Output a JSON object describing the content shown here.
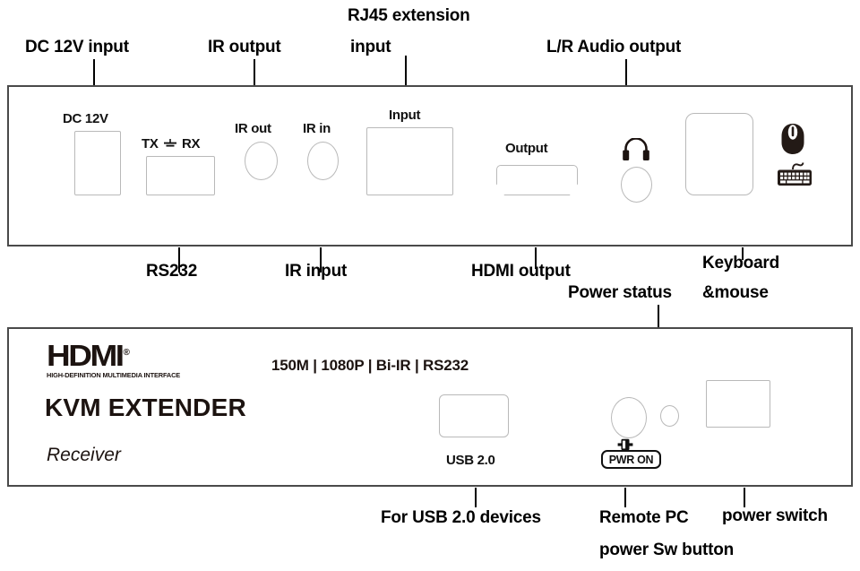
{
  "diagram": {
    "title": "HDMI KVM Extender Receiver port diagram",
    "line_color": "#000000",
    "panel_border_color": "#4a4a4a",
    "port_outline_color": "#b9b9b9",
    "brand_color": "#1c1310"
  },
  "top_panel": {
    "name": "receiver-rear-panel",
    "callouts_above": [
      {
        "id": "dc-12v-input",
        "label": "DC 12V input"
      },
      {
        "id": "ir-output",
        "label": "IR output"
      },
      {
        "id": "rj45-extension-input",
        "label_line1": "RJ45 extension",
        "label_line2": "input"
      },
      {
        "id": "lr-audio-output",
        "label": "L/R Audio output"
      }
    ],
    "callouts_below": [
      {
        "id": "rs232",
        "label": "RS232"
      },
      {
        "id": "ir-input",
        "label": "IR input"
      },
      {
        "id": "hdmi-output",
        "label": "HDMI output"
      },
      {
        "id": "power-status",
        "label": "Power status"
      },
      {
        "id": "keyboard-mouse",
        "label_line1": "Keyboard",
        "label_line2": "&mouse"
      }
    ],
    "port_labels": {
      "dc_jack": "DC 12V",
      "serial_tx": "TX",
      "serial_rx": "RX",
      "ir_out": "IR out",
      "ir_in": "IR in",
      "rj45_input": "Input",
      "hdmi_output": "Output"
    },
    "icons": {
      "ground": "ground-symbol",
      "audio": "headphone-icon",
      "mouse": "mouse-icon",
      "keyboard": "keyboard-icon"
    }
  },
  "bottom_panel": {
    "name": "receiver-front-panel",
    "brand": {
      "wordmark": "HDMI",
      "registered": "®",
      "subtitle": "HIGH-DEFINITION MULTIMEDIA INTERFACE"
    },
    "model": "KVM EXTENDER",
    "role": "Receiver",
    "specs": "150M | 1080P | Bi-IR | RS232",
    "port_labels": {
      "usb": "USB 2.0",
      "power_button": "PWR ON"
    },
    "callouts_below": [
      {
        "id": "usb-devices",
        "label": "For USB 2.0 devices"
      },
      {
        "id": "remote-pc-power",
        "label_line1": "Remote PC",
        "label_line2": "power Sw button"
      },
      {
        "id": "power-switch",
        "label": "power switch"
      }
    ]
  }
}
